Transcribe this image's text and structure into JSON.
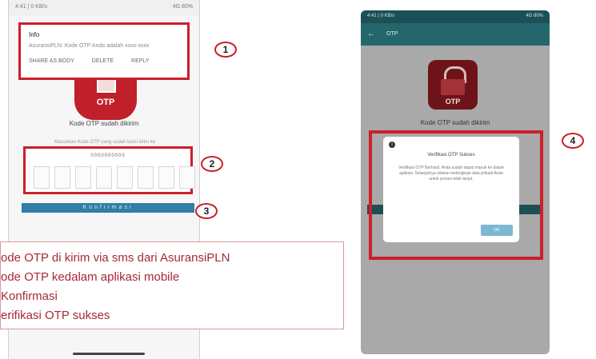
{
  "left_phone": {
    "status_left": "4:41 | 0 KB/s",
    "status_right": "4G 80%",
    "notification": {
      "sender": "Info",
      "message": "AsuransiPLN: Kode OTP Anda adalah xxxx-xxxx",
      "actions": [
        "SHARE AS BODY",
        "DELETE",
        "REPLY"
      ]
    },
    "otp_logo_text": "OTP",
    "screen_title": "Kode OTP sudah dikirim",
    "instruction": "Masukkan Kode OTP yang sudah kami kirim ke",
    "phone_number": "0000000000",
    "confirm_label": "Konfirmasi"
  },
  "markers": [
    "1",
    "2",
    "3",
    "4"
  ],
  "steps": [
    "ode OTP di kirim via sms dari AsuransiPLN",
    "ode OTP kedalam aplikasi mobile",
    " Konfirmasi",
    "erifikasi OTP sukses"
  ],
  "right_phone": {
    "status_left": "4:41 | 0 KB/s",
    "status_right": "4G 80%",
    "back_icon": "back-arrow-icon",
    "appbar_title": "OTP",
    "otp_logo_text": "OTP",
    "screen_title": "Kode OTP sudah dikirim",
    "dialog": {
      "title": "Verifikasi OTP Sukses",
      "body": "Verifikasi OTP Berhasil. Anda sudah dapat masuk ke dalam aplikasi. Selanjutnya silakan melengkapi data pribadi Anda untuk proses lebih lanjut.",
      "ok_label": "OK"
    }
  },
  "colors": {
    "highlight_red": "#cc1f2a",
    "brand_red": "#c0202a",
    "teal": "#23676d",
    "confirm_blue": "#2f7fa6"
  }
}
